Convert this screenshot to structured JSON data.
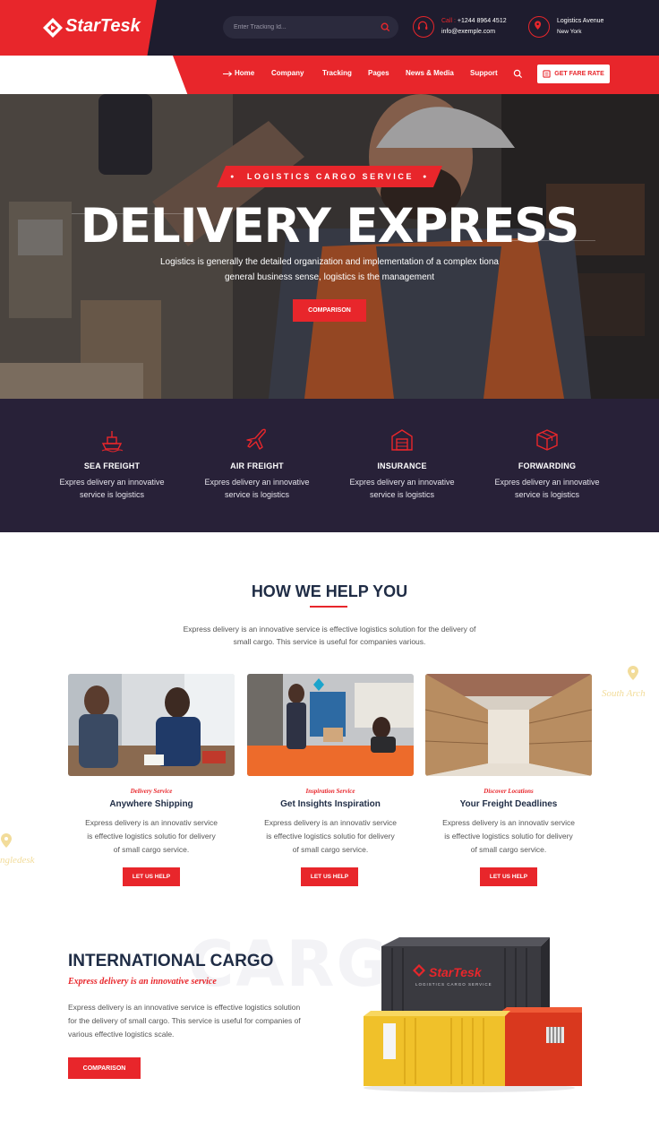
{
  "brand": {
    "name": "StarTesk",
    "accent": "#e8262b",
    "dark": "#1e1c2e"
  },
  "header": {
    "tracking_placeholder": "Enter Tracking Id...",
    "call_label": "Call :",
    "phone": "+1244 8964 4512",
    "email": "info@exemple.com",
    "address_line1": "Logistics Avenue",
    "address_line2": "New York"
  },
  "nav": {
    "items": [
      "Home",
      "Company",
      "Tracking",
      "Pages",
      "News & Media",
      "Support"
    ],
    "fare_label": "GET FARE RATE"
  },
  "hero": {
    "ribbon": "LOGISTICS CARGO SERVICE",
    "title": "DELIVERY EXPRESS",
    "subtitle_line1": "Logistics is generally the detailed organization and implementation of a complex tiona",
    "subtitle_line2": "general business sense, logistics is the management",
    "button": "COMPARISON"
  },
  "services": [
    {
      "title": "SEA FREIGHT",
      "text1": "Expres delivery an innovative",
      "text2": "service is logistics",
      "icon": "ship-icon"
    },
    {
      "title": "AIR FREIGHT",
      "text1": "Expres delivery an innovative",
      "text2": "service is logistics",
      "icon": "plane-icon"
    },
    {
      "title": "INSURANCE",
      "text1": "Expres delivery an innovative",
      "text2": "service is logistics",
      "icon": "warehouse-icon"
    },
    {
      "title": "FORWARDING",
      "text1": "Expres delivery an innovative",
      "text2": "service is logistics",
      "icon": "box-icon"
    }
  ],
  "help": {
    "title": "HOW WE HELP YOU",
    "subtitle_line1": "Express delivery is an innovative service is effective logistics solution for the delivery of",
    "subtitle_line2": "small cargo. This service is useful for companies various.",
    "cards": [
      {
        "caption": "Delivery Service",
        "title": "Anywhere Shipping",
        "l1": "Express delivery is an innovativ service",
        "l2": "is effective logistics solutio for delivery",
        "l3": "of small cargo service.",
        "button": "LET US HELP"
      },
      {
        "caption": "Inspiration Service",
        "title": "Get Insights Inspiration",
        "l1": "Express delivery is an innovativ service",
        "l2": "is effective logistics solutio for delivery",
        "l3": "of small cargo service.",
        "button": "LET US HELP"
      },
      {
        "caption": "Discover Locations",
        "title": "Your Freight Deadlines",
        "l1": "Express delivery is an innovativ service",
        "l2": "is effective logistics solutio for delivery",
        "l3": "of small cargo service.",
        "button": "LET US HELP"
      }
    ]
  },
  "intl": {
    "bg_word": "CARGO",
    "title": "INTERNATIONAL CARGO",
    "subtitle": "Express delivery is an innovative service",
    "l1": "Express delivery is an innovative service is effective logistics solution",
    "l2": "for the delivery of small cargo. This service is useful for companies of",
    "l3": "various effective logistics scale.",
    "button": "COMPARISON",
    "container_brand": "StarTesk",
    "container_tag": "LOGISTICS CARGO SERVICE"
  },
  "decor": {
    "watermark_right": "South Arch",
    "watermark_left": "ngledesk"
  }
}
